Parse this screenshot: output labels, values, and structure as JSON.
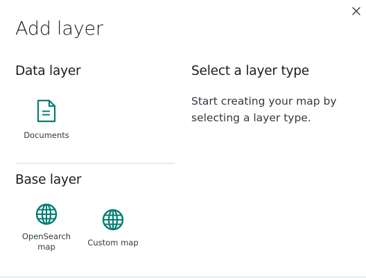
{
  "modal": {
    "title": "Add layer",
    "close_icon": "close-icon"
  },
  "data_layer": {
    "heading": "Data layer",
    "items": [
      {
        "label": "Documents",
        "icon": "document-icon"
      }
    ]
  },
  "base_layer": {
    "heading": "Base layer",
    "items": [
      {
        "label": "OpenSearch map",
        "icon": "globe-icon"
      },
      {
        "label": "Custom map",
        "icon": "globe-icon"
      }
    ]
  },
  "info_panel": {
    "heading": "Select a layer type",
    "description": "Start creating your map by selecting a layer type."
  },
  "colors": {
    "accent": "#017d73",
    "text": "#1a1c21",
    "divider": "#d3dae6"
  }
}
